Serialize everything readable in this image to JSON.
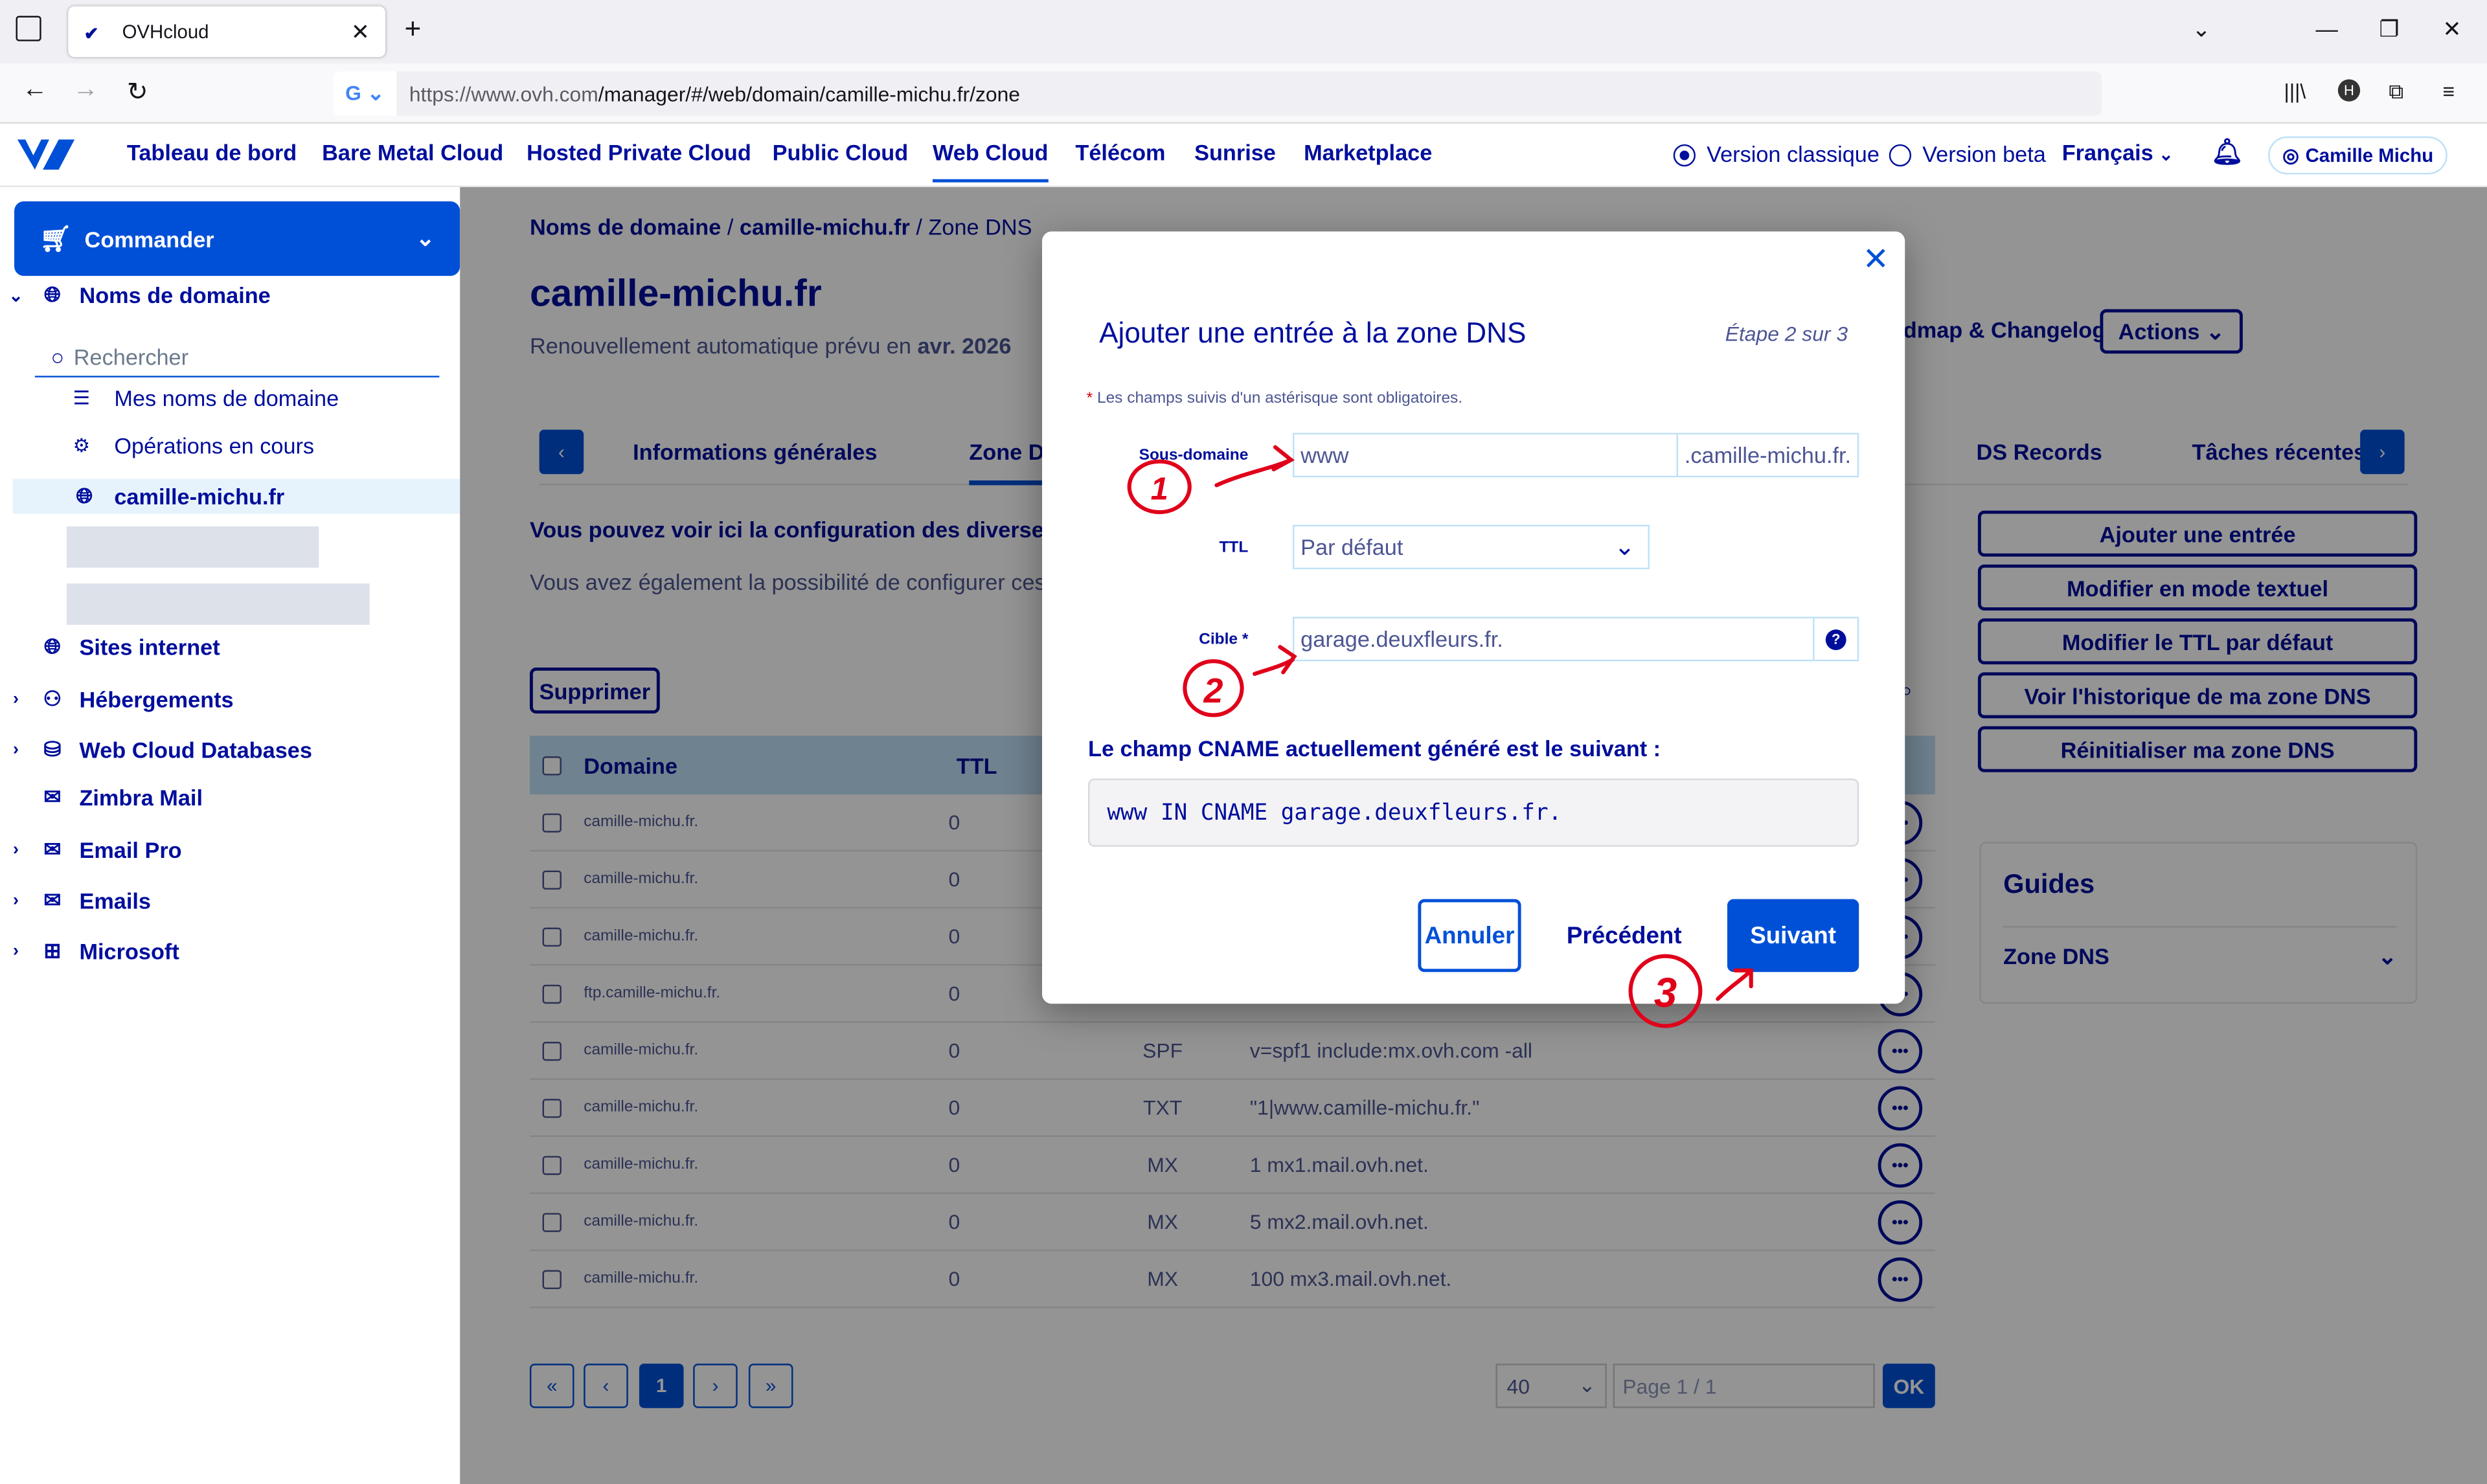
{
  "browser": {
    "tab_title": "OVHcloud",
    "url_host": "https://www.ovh.com",
    "url_path": "/manager/#/web/domain/camille-michu.fr/zone"
  },
  "header": {
    "nav": [
      "Tableau de bord",
      "Bare Metal Cloud",
      "Hosted Private Cloud",
      "Public Cloud",
      "Web Cloud",
      "Télécom",
      "Sunrise",
      "Marketplace"
    ],
    "active_nav": "Web Cloud",
    "version_classic": "Version classique",
    "version_beta": "Version beta",
    "language": "Français",
    "user": "Camille Michu"
  },
  "sidebar": {
    "order_label": "Commander",
    "domains_label": "Noms de domaine",
    "search_placeholder": "Rechercher",
    "my_domains": "Mes noms de domaine",
    "operations": "Opérations en cours",
    "selected_domain": "camille-michu.fr",
    "items": [
      "Sites internet",
      "Hébergements",
      "Web Cloud Databases",
      "Zimbra Mail",
      "Email Pro",
      "Emails",
      "Microsoft"
    ]
  },
  "main": {
    "breadcrumb_1": "Noms de domaine",
    "breadcrumb_2": "camille-michu.fr",
    "breadcrumb_3": "Zone DNS",
    "title": "camille-michu.fr",
    "renew_text": "Renouvellement automatique prévu en ",
    "renew_date": "avr. 2026",
    "roadmap": "Roadmap & Changelog",
    "roadmap_visible": "dmap & Changelog",
    "actions": "Actions",
    "tabs": {
      "general": "Informations générales",
      "zone": "Zone DNS",
      "zone_visible": "Zone Di",
      "ds": "DS Records",
      "tasks": "Tâches récentes"
    },
    "info_1": "Vous pouvez voir ici la configuration des diverses e",
    "info_2": "Vous avez également la possibilité de configurer ces (",
    "delete_btn": "Supprimer",
    "columns": {
      "domain": "Domaine",
      "ttl": "TTL"
    },
    "rows": [
      {
        "domain": "camille-michu.fr.",
        "ttl": "0",
        "type": "",
        "target": ""
      },
      {
        "domain": "camille-michu.fr.",
        "ttl": "0",
        "type": "",
        "target": ""
      },
      {
        "domain": "camille-michu.fr.",
        "ttl": "0",
        "type": "",
        "target": ""
      },
      {
        "domain": "ftp.camille-michu.fr.",
        "ttl": "0",
        "type": "",
        "target": ""
      },
      {
        "domain": "camille-michu.fr.",
        "ttl": "0",
        "type": "SPF",
        "target": "v=spf1 include:mx.ovh.com -all"
      },
      {
        "domain": "camille-michu.fr.",
        "ttl": "0",
        "type": "TXT",
        "target": "\"1|www.camille-michu.fr.\""
      },
      {
        "domain": "camille-michu.fr.",
        "ttl": "0",
        "type": "MX",
        "target": "1 mx1.mail.ovh.net."
      },
      {
        "domain": "camille-michu.fr.",
        "ttl": "0",
        "type": "MX",
        "target": "5 mx2.mail.ovh.net."
      },
      {
        "domain": "camille-michu.fr.",
        "ttl": "0",
        "type": "MX",
        "target": "100 mx3.mail.ovh.net."
      }
    ],
    "side_actions": [
      "Ajouter une entrée",
      "Modifier en mode textuel",
      "Modifier le TTL par défaut",
      "Voir l'historique de ma zone DNS",
      "Réinitialiser ma zone DNS"
    ],
    "guides_title": "Guides",
    "guides_item": "Zone DNS",
    "pagination": {
      "current": "1",
      "page_size": "40",
      "page_text": "Page 1 / 1",
      "ok": "OK"
    }
  },
  "modal": {
    "title": "Ajouter une entrée à la zone DNS",
    "step": "Étape 2 sur 3",
    "required_note": "Les champs suivis d'un astérisque sont obligatoires.",
    "subdomain_label": "Sous-domaine",
    "subdomain_value": "www",
    "subdomain_suffix": ".camille-michu.fr.",
    "ttl_label": "TTL",
    "ttl_value": "Par défaut",
    "target_label": "Cible",
    "target_value": "garage.deuxfleurs.fr.",
    "cname_label": "Le champ CNAME actuellement généré est le suivant :",
    "cname_value": "www IN CNAME garage.deuxfleurs.fr.",
    "cancel": "Annuler",
    "previous": "Précédent",
    "next": "Suivant"
  },
  "annotations": {
    "n1": "1",
    "n2": "2",
    "n3": "3",
    "color": "#e0001a"
  }
}
